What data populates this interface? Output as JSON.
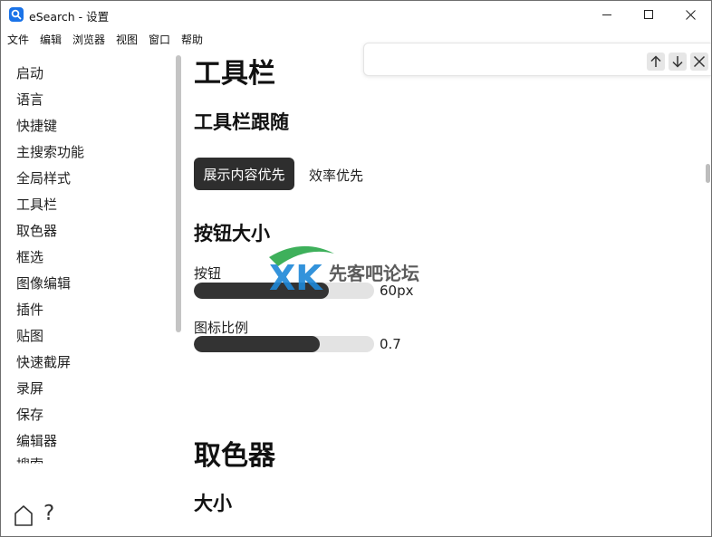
{
  "window": {
    "title": "eSearch - 设置"
  },
  "menubar": {
    "items": [
      "文件",
      "编辑",
      "浏览器",
      "视图",
      "窗口",
      "帮助"
    ]
  },
  "sidebar": {
    "items": [
      {
        "label": "启动"
      },
      {
        "label": "语言"
      },
      {
        "label": "快捷键"
      },
      {
        "label": "主搜索功能"
      },
      {
        "label": "全局样式"
      },
      {
        "label": "工具栏"
      },
      {
        "label": "取色器"
      },
      {
        "label": "框选"
      },
      {
        "label": "图像编辑"
      },
      {
        "label": "插件"
      },
      {
        "label": "贴图"
      },
      {
        "label": "快速截屏"
      },
      {
        "label": "录屏"
      },
      {
        "label": "保存"
      },
      {
        "label": "编辑器"
      },
      {
        "label": "搜索"
      }
    ],
    "footer": {
      "help_glyph": "?"
    }
  },
  "content": {
    "section_toolbar": {
      "title": "工具栏",
      "follow": {
        "title": "工具栏跟随",
        "options": [
          "展示内容优先",
          "效率优先"
        ],
        "selected_index": 0
      },
      "button_size": {
        "title": "按钮大小",
        "sliders": [
          {
            "label": "按钮",
            "value_text": "60px",
            "fraction": 0.75
          },
          {
            "label": "图标比例",
            "value_text": "0.7",
            "fraction": 0.7
          }
        ]
      }
    },
    "section_picker": {
      "title": "取色器",
      "size": {
        "title": "大小"
      }
    }
  },
  "watermark": {
    "logo_text": "XK",
    "text": "先客吧论坛"
  },
  "colors": {
    "accent": "#2e2e2e",
    "app_icon": "#1a73e8",
    "slider_track": "#e3e3e3"
  }
}
